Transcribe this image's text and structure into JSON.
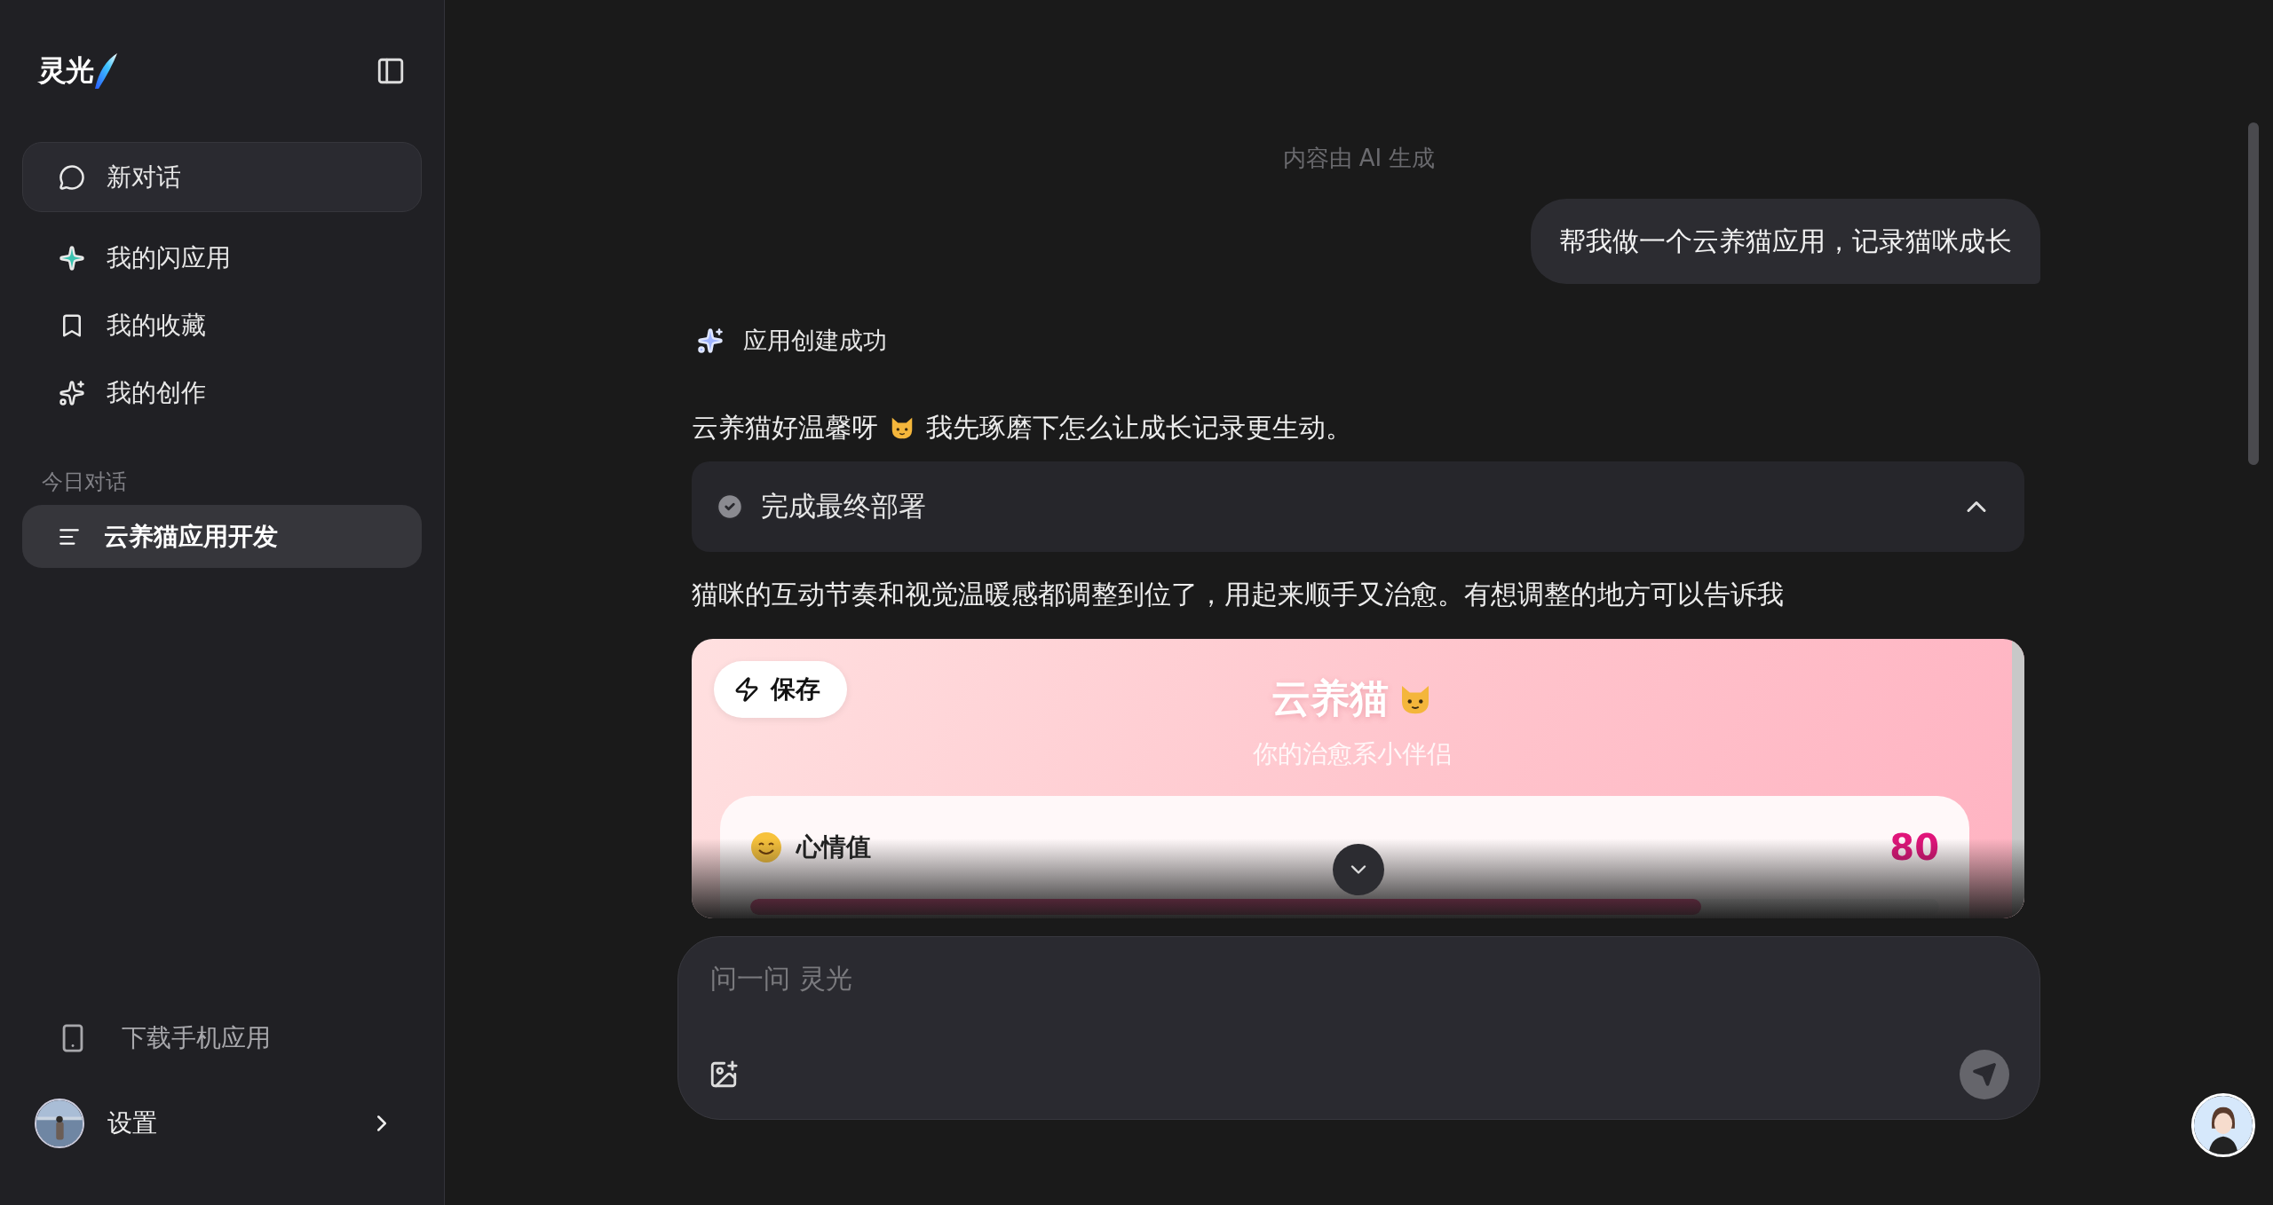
{
  "sidebar": {
    "logo": "灵光",
    "nav": [
      {
        "label": "新对话",
        "kind": "new"
      },
      {
        "label": "我的闪应用",
        "kind": "apps"
      },
      {
        "label": "我的收藏",
        "kind": "favorites"
      },
      {
        "label": "我的创作",
        "kind": "creations"
      }
    ],
    "section_title": "今日对话",
    "conversations": [
      {
        "title": "云养猫应用开发",
        "selected": true
      }
    ],
    "download": "下载手机应用",
    "settings": "设置"
  },
  "chat": {
    "notice": "内容由 AI 生成",
    "user_message": "帮我做一个云养猫应用，记录猫咪成长",
    "status": "应用创建成功",
    "reply_intro": [
      "云养猫好温馨呀",
      "我先琢磨下怎么让成长记录更生动。"
    ],
    "step": {
      "label": "完成最终部署",
      "done": true,
      "expanded": true
    },
    "reply_outro": "猫咪的互动节奏和视觉温暖感都调整到位了，用起来顺手又治愈。有想调整的地方可以告诉我",
    "preview": {
      "save": "保存",
      "title": "云养猫",
      "subtitle": "你的治愈系小伴侣",
      "stat": {
        "label": "心情值",
        "value": "80",
        "level": 0.8
      }
    }
  },
  "composer": {
    "placeholder": "问一问 灵光"
  }
}
